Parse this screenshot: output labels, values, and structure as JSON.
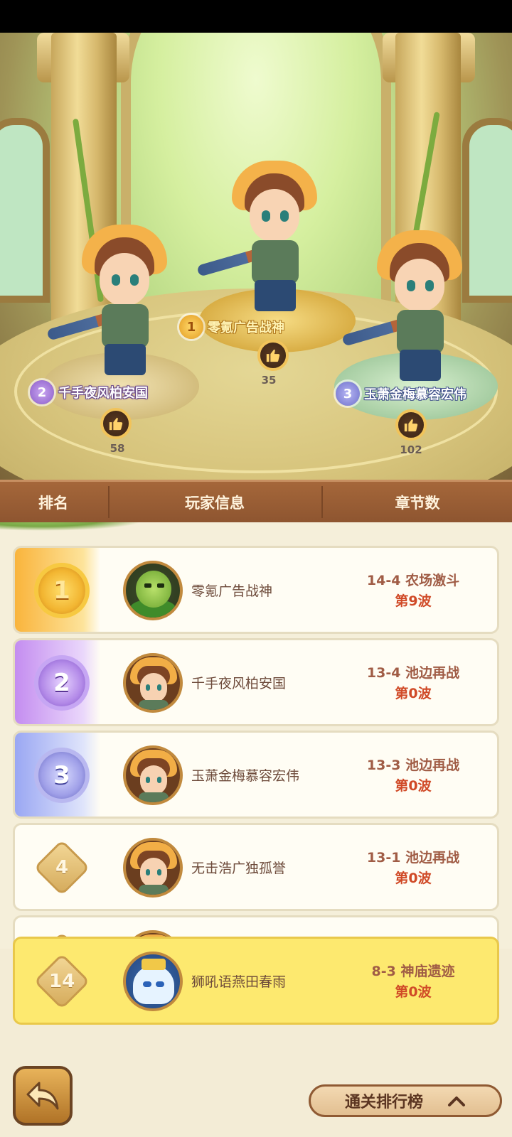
{
  "podium": [
    {
      "rank": "1",
      "name": "零氪广告战神",
      "likes": "35"
    },
    {
      "rank": "2",
      "name": "千手夜风柏安国",
      "likes": "58"
    },
    {
      "rank": "3",
      "name": "玉萧金梅慕容宏伟",
      "likes": "102"
    }
  ],
  "table_header": {
    "rank": "排名",
    "player_info": "玩家信息",
    "chapters": "章节数"
  },
  "rows": [
    {
      "rank": "1",
      "name": "零氪广告战神",
      "chapter": "14-4 农场激斗",
      "wave": "第9波",
      "avatar": "plant-avatar"
    },
    {
      "rank": "2",
      "name": "千手夜风柏安国",
      "chapter": "13-4 池边再战",
      "wave": "第0波",
      "avatar": "farmer-avatar"
    },
    {
      "rank": "3",
      "name": "玉萧金梅慕容宏伟",
      "chapter": "13-3 池边再战",
      "wave": "第0波",
      "avatar": "farmer-avatar"
    },
    {
      "rank": "4",
      "name": "无击浩广独孤誉",
      "chapter": "13-1 池边再战",
      "wave": "第0波",
      "avatar": "farmer-avatar"
    }
  ],
  "my_row": {
    "rank": "14",
    "name": "狮吼语燕田春雨",
    "chapter": "8-3 神庙遗迹",
    "wave": "第0波",
    "avatar": "ghost-king-avatar"
  },
  "footer": {
    "board_label": "通关排行榜"
  },
  "icons": {
    "like": "thumbs-up-icon",
    "back": "back-arrow-icon",
    "expand": "chevron-up-icon"
  }
}
